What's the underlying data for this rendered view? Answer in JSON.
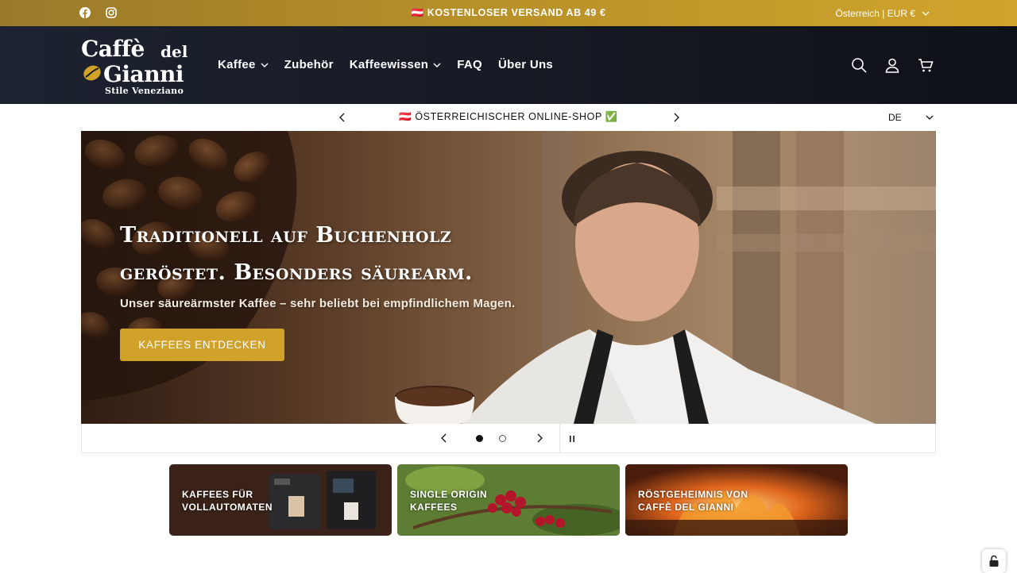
{
  "topbar": {
    "promo": "🇦🇹 KOSTENLOSER VERSAND AB 49 €",
    "locale": "Österreich | EUR €",
    "social": [
      "facebook-icon",
      "instagram-icon"
    ]
  },
  "header": {
    "logo": {
      "line1": "Caffè",
      "line1b": "del",
      "line2": "Gianni",
      "line3": "Stile Veneziano"
    },
    "nav": [
      {
        "label": "Kaffee",
        "dropdown": true
      },
      {
        "label": "Zubehör",
        "dropdown": false
      },
      {
        "label": "Kaffeewissen",
        "dropdown": true
      },
      {
        "label": "FAQ",
        "dropdown": false
      },
      {
        "label": "Über Uns",
        "dropdown": false
      }
    ],
    "icons": [
      "search-icon",
      "account-icon",
      "cart-icon"
    ]
  },
  "announcement": {
    "text": "🇦🇹 ÖSTERREICHISCHER ONLINE-SHOP ✅",
    "language": "DE"
  },
  "hero": {
    "heading_line1": "Traditionell auf Buchenholz",
    "heading_line2": "geröstet. Besonders säurearm.",
    "subheading": "Unser säureärmster Kaffee – sehr beliebt bei empfindlichem Magen.",
    "cta": "KAFFEES ENTDECKEN"
  },
  "slider": {
    "total": 2,
    "active": 1
  },
  "tiles": [
    {
      "line1": "KAFFEES FÜR",
      "line2": "VOLLAUTOMATEN"
    },
    {
      "line1": "SINGLE ORIGIN",
      "line2": "KAFFEES"
    },
    {
      "line1": "RÖSTGEHEIMNIS VON",
      "line2": "CAFFÈ DEL GIANNI"
    }
  ],
  "colors": {
    "gold": "#d1a22a",
    "header_dark": "#161a24"
  }
}
